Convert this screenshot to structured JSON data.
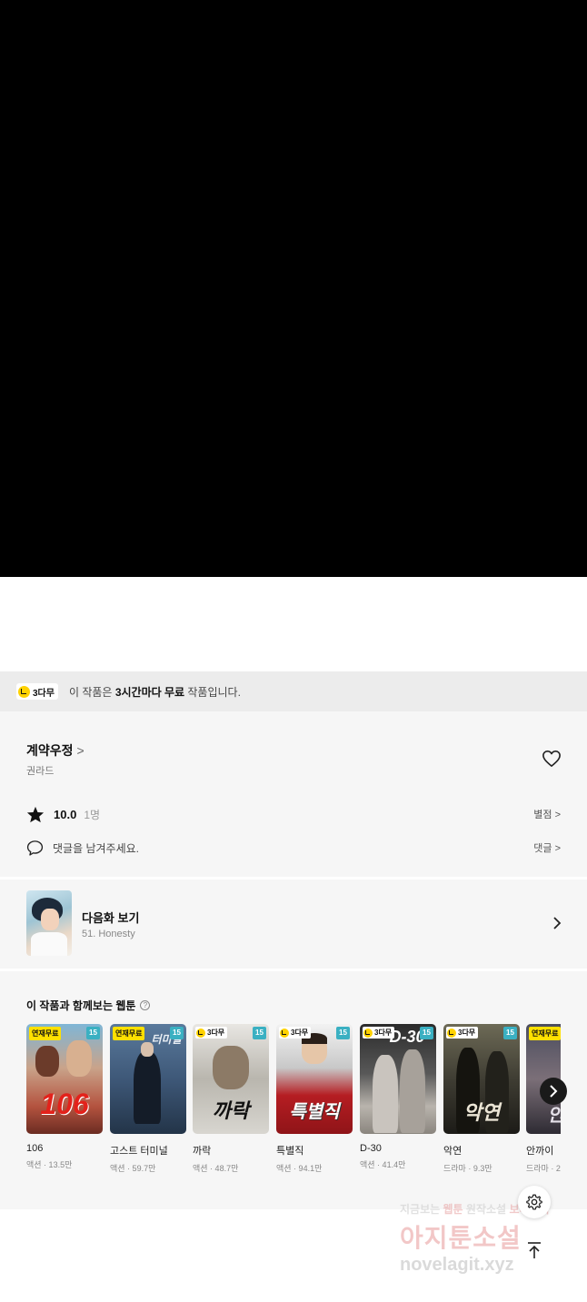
{
  "notice": {
    "badge_label": "3다무",
    "text_prefix": "이 작품은 ",
    "text_bold": "3시간마다 무료",
    "text_suffix": " 작품입니다."
  },
  "series": {
    "title": "계약우정",
    "chevron": ">",
    "author": "권라드",
    "rating_value": "10.0",
    "rating_count": "1명",
    "rate_label": "별점",
    "comment_placeholder": "댓글을 남겨주세요.",
    "comment_label": "댓글",
    "link_chevron": ">"
  },
  "next_episode": {
    "label": "다음화 보기",
    "episode": "51. Honesty"
  },
  "recommend": {
    "title": "이 작품과 함께보는 웹툰",
    "help": "?",
    "items": [
      {
        "title": "106",
        "meta": "액션 · 13.5만",
        "badge": "연재무료",
        "age": "15",
        "cover_text": "106"
      },
      {
        "title": "고스트 터미널",
        "meta": "액션 · 59.7만",
        "badge": "연재무료",
        "age": "15",
        "cover_text": "터미널"
      },
      {
        "title": "까락",
        "meta": "액션 · 48.7만",
        "badge": "3다무",
        "age": "15",
        "cover_text": "까락"
      },
      {
        "title": "특별직",
        "meta": "액션 · 94.1만",
        "badge": "3다무",
        "age": "15",
        "cover_text": "특별직"
      },
      {
        "title": "D-30",
        "meta": "액션 · 41.4만",
        "badge": "3다무",
        "age": "15",
        "cover_text": "D-30"
      },
      {
        "title": "악연",
        "meta": "드라마 · 9.3만",
        "badge": "3다무",
        "age": "15",
        "cover_text": "악연"
      },
      {
        "title": "안까이",
        "meta": "드라마 · 2",
        "badge": "연재무료",
        "age": "",
        "cover_text": "안까"
      }
    ]
  },
  "watermark": {
    "line1_a": "지금보는 ",
    "line1_b": "웹툰",
    "line1_c": " 원작소설 ",
    "line1_d": "보러가기",
    "line2": "아지툰소설",
    "line3": "novelagit.xyz"
  },
  "colors": {
    "free_badge": "#ffe000",
    "age_badge": "#3ab0c2",
    "clock_yellow": "#ffd200"
  }
}
